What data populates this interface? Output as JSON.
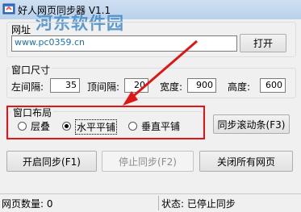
{
  "window": {
    "title": "好人网页同步器 V1.1",
    "watermark": "河东软件园",
    "watermark_url": "www.pc0359.cn"
  },
  "url_group": {
    "label": "网址",
    "url_value": "",
    "open_button": "打开"
  },
  "window_size": {
    "label": "窗口尺寸",
    "left_label": "左间隔:",
    "left_value": "35",
    "top_label": "顶间隔:",
    "top_value": "20",
    "width_label": "宽度:",
    "width_value": "900",
    "height_label": "高度:",
    "height_value": "600"
  },
  "layout": {
    "label": "窗口布局",
    "options": [
      {
        "label": "层叠",
        "selected": false
      },
      {
        "label": "水平平铺",
        "selected": true
      },
      {
        "label": "垂直平铺",
        "selected": false
      }
    ]
  },
  "buttons": {
    "scroll": "同步滚动条(F3)",
    "start": "开启同步(F1)",
    "stop": "停止同步(F2)",
    "close_all": "关闭所有网页"
  },
  "status_bar": {
    "page_count": "网页数量: 0",
    "state": "状态: 已停止同步"
  },
  "colors": {
    "highlight": "#e01616",
    "arrow": "#e01616"
  }
}
